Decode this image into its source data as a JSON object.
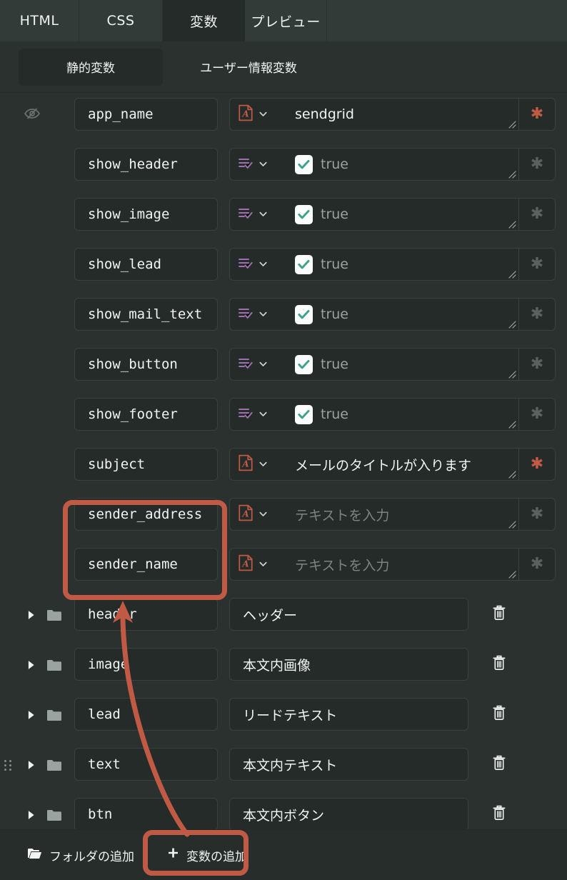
{
  "tabs": {
    "items": [
      {
        "label": "HTML",
        "active": false
      },
      {
        "label": "CSS",
        "active": false
      },
      {
        "label": "変数",
        "active": true
      },
      {
        "label": "プレビュー",
        "active": false
      }
    ]
  },
  "subtabs": {
    "items": [
      {
        "label": "静的変数",
        "active": true
      },
      {
        "label": "ユーザー情報変数",
        "active": false
      }
    ]
  },
  "variables": [
    {
      "name": "app_name",
      "type": "text",
      "type_icon": "text-type-icon",
      "value": "sendgrid",
      "is_placeholder": false,
      "required": true,
      "hidden_icon": "eye-off-icon"
    },
    {
      "name": "show_header",
      "type": "boolean",
      "type_icon": "boolean-type-icon",
      "value": "true",
      "is_placeholder": false,
      "required": false,
      "checked": true
    },
    {
      "name": "show_image",
      "type": "boolean",
      "type_icon": "boolean-type-icon",
      "value": "true",
      "is_placeholder": false,
      "required": false,
      "checked": true
    },
    {
      "name": "show_lead",
      "type": "boolean",
      "type_icon": "boolean-type-icon",
      "value": "true",
      "is_placeholder": false,
      "required": false,
      "checked": true
    },
    {
      "name": "show_mail_text",
      "type": "boolean",
      "type_icon": "boolean-type-icon",
      "value": "true",
      "is_placeholder": false,
      "required": false,
      "checked": true
    },
    {
      "name": "show_button",
      "type": "boolean",
      "type_icon": "boolean-type-icon",
      "value": "true",
      "is_placeholder": false,
      "required": false,
      "checked": true
    },
    {
      "name": "show_footer",
      "type": "boolean",
      "type_icon": "boolean-type-icon",
      "value": "true",
      "is_placeholder": false,
      "required": false,
      "checked": true
    },
    {
      "name": "subject",
      "type": "text",
      "type_icon": "text-type-icon",
      "value": "メールのタイトルが入ります",
      "is_placeholder": false,
      "required": true
    },
    {
      "name": "sender_address",
      "type": "text",
      "type_icon": "text-type-icon",
      "value": "テキストを入力",
      "is_placeholder": true,
      "required": false
    },
    {
      "name": "sender_name",
      "type": "text",
      "type_icon": "text-type-icon",
      "value": "テキストを入力",
      "is_placeholder": true,
      "required": false
    }
  ],
  "folders": [
    {
      "name": "header",
      "description": "ヘッダー",
      "expanded": false,
      "drag_handle": false
    },
    {
      "name": "image",
      "description": "本文内画像",
      "expanded": false,
      "drag_handle": false
    },
    {
      "name": "lead",
      "description": "リードテキスト",
      "expanded": false,
      "drag_handle": false
    },
    {
      "name": "text",
      "description": "本文内テキスト",
      "expanded": false,
      "drag_handle": true
    },
    {
      "name": "btn",
      "description": "本文内ボタン",
      "expanded": false,
      "drag_handle": false
    }
  ],
  "required_marker": "✱",
  "placeholder_text": "テキストを入力",
  "bottom_bar": {
    "add_folder_label": "フォルダの追加",
    "add_folder_icon": "folder-open-icon",
    "add_variable_label": "変数の追加",
    "add_variable_icon": "plus-icon"
  },
  "colors": {
    "page_bg": "#2a312f",
    "tab_bg": "#323b38",
    "tab_active_bg": "#242b29",
    "field_bg": "#242b29",
    "field_border": "#39423f",
    "text": "#f2f4f3",
    "placeholder": "#7c8582",
    "accent_red": "#c05a45",
    "type_text_icon": "#c05a45",
    "type_bool_icon": "#a06fb0",
    "check_teal": "#3fa08d",
    "annotation": "#c05a45"
  },
  "annotations": {
    "highlight_fields_label": "sender-fields-highlight",
    "highlight_button_label": "add-variable-highlight",
    "arrow_label": "annotation-arrow"
  }
}
